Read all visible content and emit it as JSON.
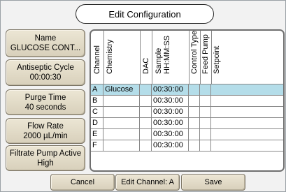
{
  "title": "Edit Configuration",
  "side_buttons": [
    {
      "label": "Name",
      "value": "GLUCOSE CONT..."
    },
    {
      "label": "Antiseptic Cycle",
      "value": "00:00:30"
    },
    {
      "label": "Purge Time",
      "value": "40 seconds"
    },
    {
      "label": "Flow Rate",
      "value": "2000 µL/min"
    },
    {
      "label": "Filtrate Pump Active",
      "value": "High"
    }
  ],
  "table": {
    "headers": {
      "channel": "Channel",
      "chemistry": "Chemistry",
      "dac": "DAC",
      "sample_line1": "Sample",
      "sample_line2": "HH:MM:SS",
      "control_type": "Control Type",
      "feed_pump": "Feed Pump",
      "setpoint": "Setpoint"
    },
    "rows": [
      {
        "channel": "A",
        "chemistry": "Glucose",
        "sample": "00:30:00"
      },
      {
        "channel": "B",
        "chemistry": "",
        "sample": "00:30:00"
      },
      {
        "channel": "C",
        "chemistry": "",
        "sample": "00:30:00"
      },
      {
        "channel": "D",
        "chemistry": "",
        "sample": "00:30:00"
      },
      {
        "channel": "E",
        "chemistry": "",
        "sample": "00:30:00"
      },
      {
        "channel": "F",
        "chemistry": "",
        "sample": "00:30:00"
      }
    ],
    "selected_row": "A",
    "selected_color": "#b4dde9"
  },
  "footer": {
    "cancel": "Cancel",
    "edit_channel": "Edit Channel: A",
    "save": "Save"
  }
}
